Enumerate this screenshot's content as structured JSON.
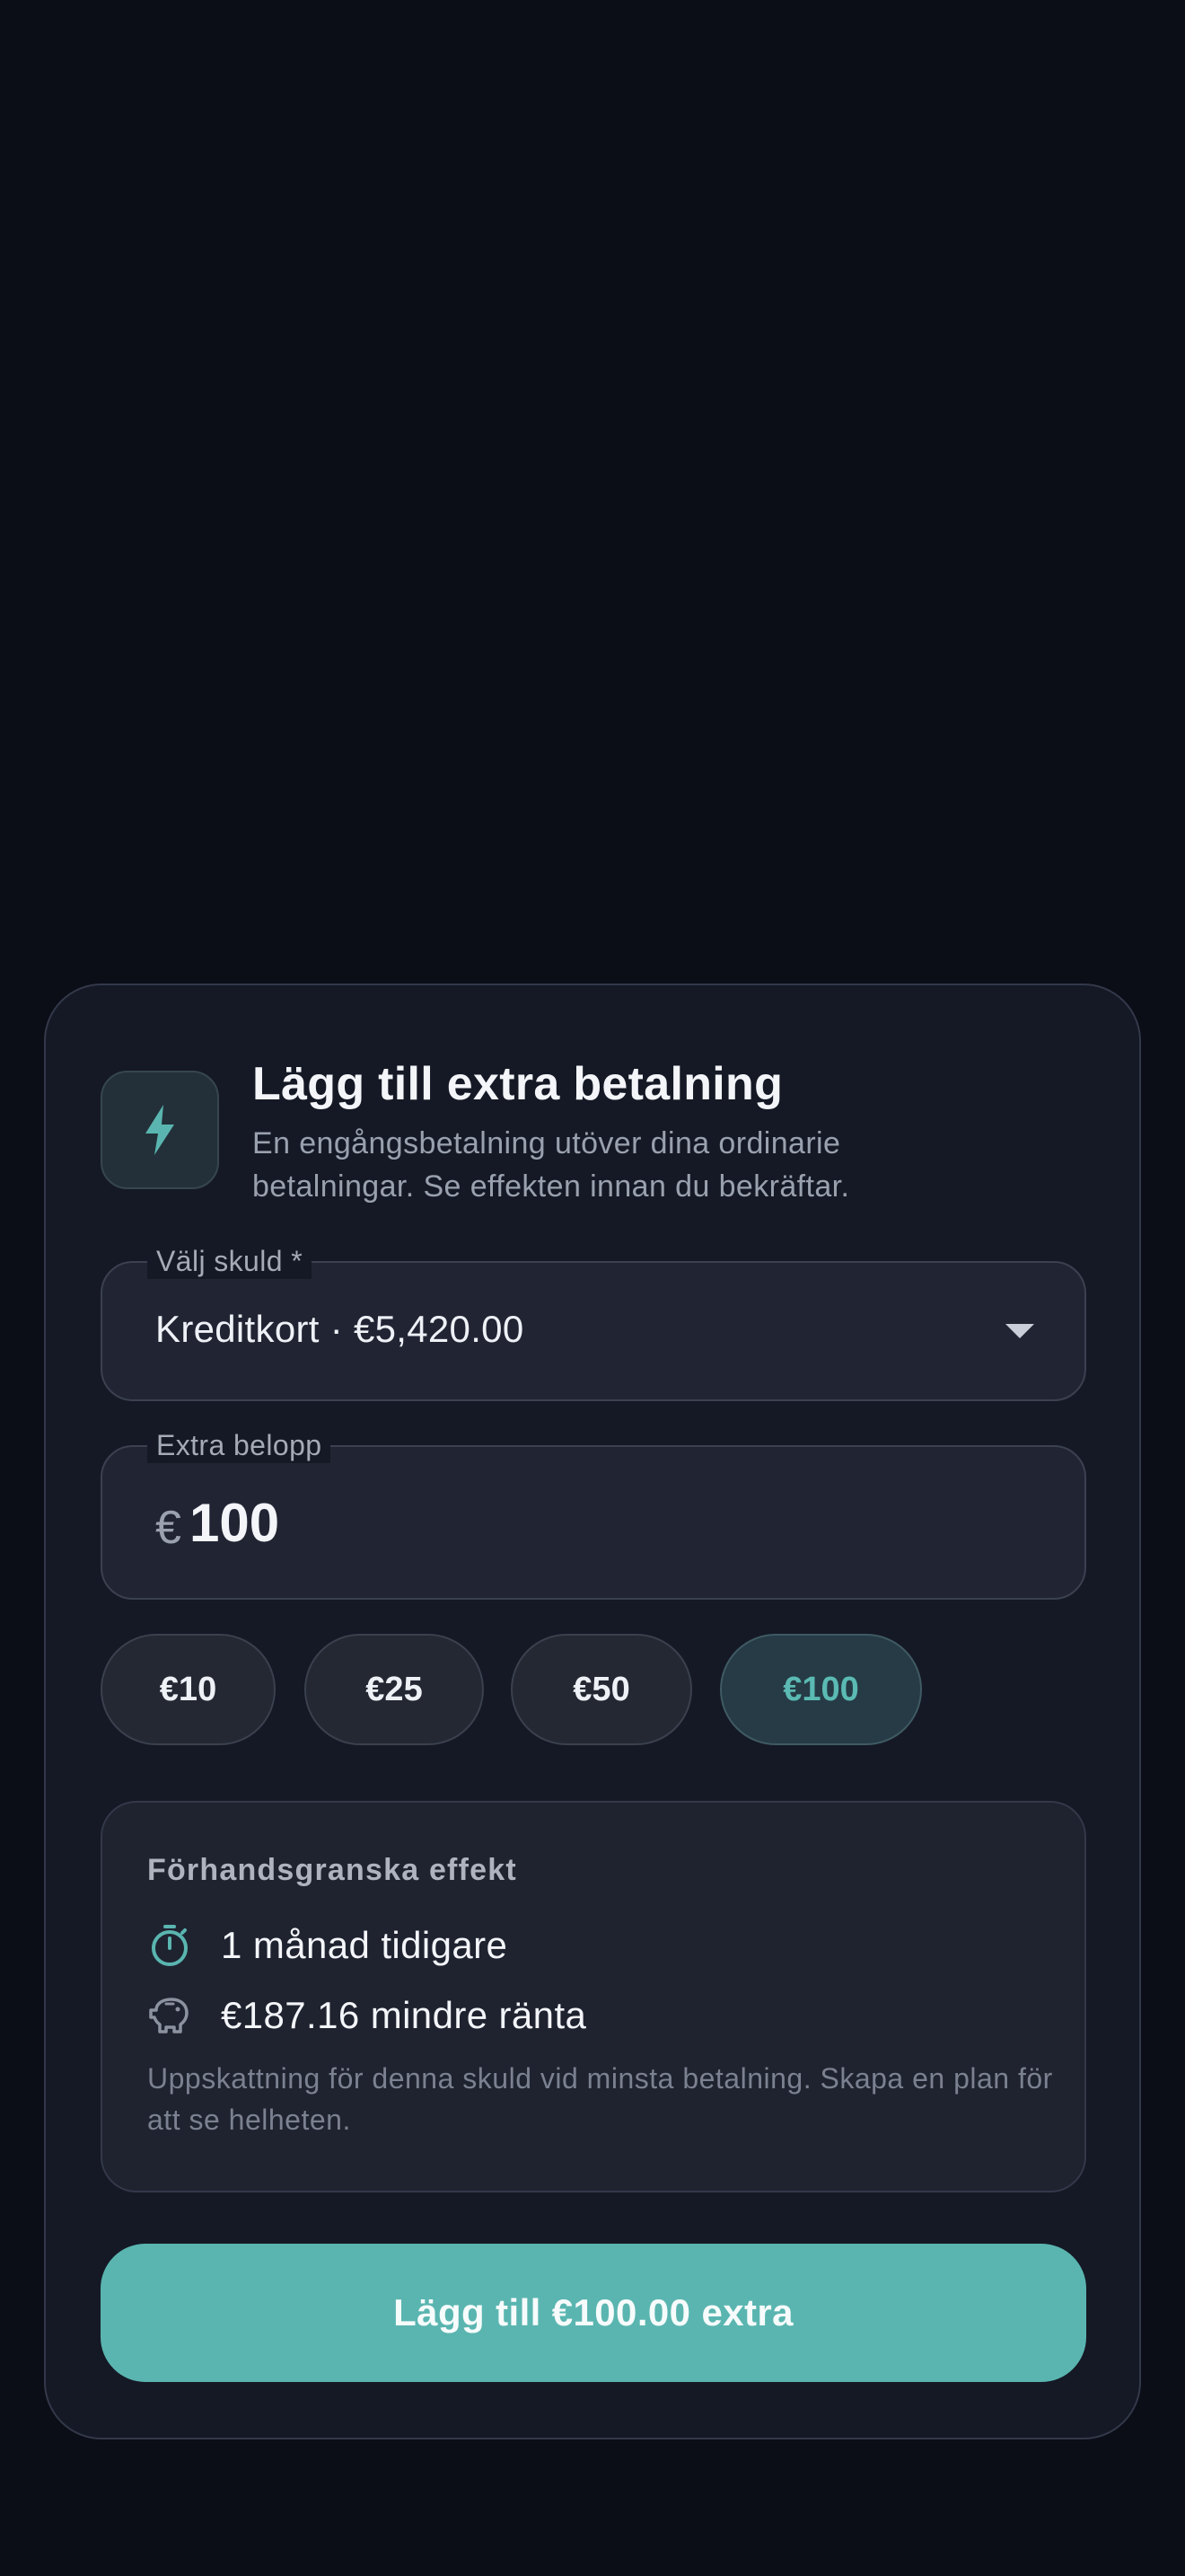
{
  "dialog": {
    "title": "Lägg till extra betalning",
    "subtitle": "En engångsbetalning utöver dina ordinarie betalningar. Se effekten innan du bekräftar.",
    "icon": "lightning-bolt-icon",
    "accent_color": "#5ab5b0"
  },
  "debt_select": {
    "label": "Välj skuld *",
    "value": "Kreditkort · €5,420.00"
  },
  "amount": {
    "label": "Extra belopp",
    "currency": "€",
    "value": "100"
  },
  "chips": [
    {
      "label": "€10",
      "selected": false
    },
    {
      "label": "€25",
      "selected": false
    },
    {
      "label": "€50",
      "selected": false
    },
    {
      "label": "€100",
      "selected": true
    }
  ],
  "preview": {
    "title": "Förhandsgranska effekt",
    "rows": [
      {
        "icon": "stopwatch-icon",
        "text": "1 månad tidigare"
      },
      {
        "icon": "piggy-bank-icon",
        "text": "€187.16 mindre ränta"
      }
    ],
    "note": "Uppskattning för denna skuld vid minsta betalning. Skapa en plan för att se helheten."
  },
  "submit": {
    "label": "Lägg till €100.00 extra"
  }
}
